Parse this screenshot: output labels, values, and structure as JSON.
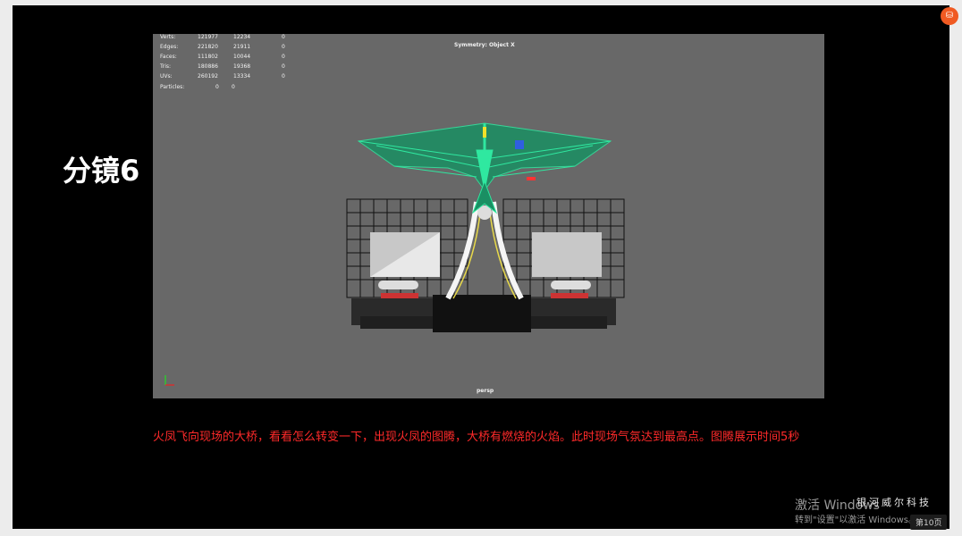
{
  "slide_title": "分镜6",
  "viewport": {
    "stats": [
      {
        "label": "Verts:",
        "a": "121977",
        "b": "12234",
        "c": "0"
      },
      {
        "label": "Edges:",
        "a": "221820",
        "b": "21911",
        "c": "0"
      },
      {
        "label": "Faces:",
        "a": "111802",
        "b": "10044",
        "c": "0"
      },
      {
        "label": "Tris:",
        "a": "180886",
        "b": "19368",
        "c": "0"
      },
      {
        "label": "UVs:",
        "a": "260192",
        "b": "13334",
        "c": "0"
      }
    ],
    "particles": {
      "label": "Particles:",
      "a": "0",
      "b": "0"
    },
    "symmetry": "Symmetry: Object X",
    "camera": "persp"
  },
  "caption": "火凤飞向现场的大桥，看看怎么转变一下，出现火凤的图腾，大桥有燃烧的火焰。此时现场气氛达到最高点。图腾展示时间5秒",
  "company": "银河威尔科技",
  "watermark": {
    "line1": "激活 Windows",
    "line2": "转到\"设置\"以激活 Windows。"
  },
  "page_number": "第10页",
  "colors": {
    "caption": "#ff2a2a",
    "viewport_bg": "#686868",
    "bird": "#2fe8a0"
  }
}
